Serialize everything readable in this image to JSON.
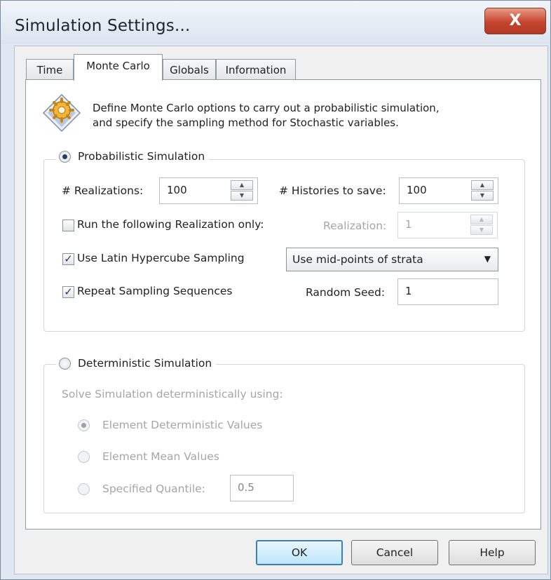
{
  "window": {
    "title": "Simulation Settings...",
    "close_label": "X"
  },
  "tabs": [
    {
      "label": "Time",
      "active": false
    },
    {
      "label": "Monte Carlo",
      "active": true
    },
    {
      "label": "Globals",
      "active": false
    },
    {
      "label": "Information",
      "active": false
    }
  ],
  "info": {
    "icon": "gear-diamond-icon",
    "line1": "Define Monte Carlo options to carry out a probabilistic simulation,",
    "line2": "and specify the sampling method for Stochastic variables."
  },
  "probabilistic": {
    "label": "Probabilistic Simulation",
    "selected": true,
    "realizations_label": "# Realizations:",
    "realizations_value": "100",
    "histories_label": "# Histories to save:",
    "histories_value": "100",
    "run_only_label": "Run the following Realization only:",
    "run_only_checked": false,
    "realization_label": "Realization:",
    "realization_value": "1",
    "lhs_label": "Use Latin Hypercube Sampling",
    "lhs_checked": true,
    "lhs_method": "Use mid-points of strata",
    "repeat_label": "Repeat Sampling Sequences",
    "repeat_checked": true,
    "seed_label": "Random Seed:",
    "seed_value": "1",
    "check_mark": "✓",
    "spin_up": "▲",
    "spin_down": "▼",
    "dropdown_arrow": "▼"
  },
  "deterministic": {
    "label": "Deterministic Simulation",
    "selected": false,
    "solve_label": "Solve Simulation deterministically using:",
    "options": [
      {
        "label": "Element Deterministic Values",
        "selected": true
      },
      {
        "label": "Element Mean Values",
        "selected": false
      },
      {
        "label": "Specified Quantile:",
        "selected": false
      }
    ],
    "quantile_value": "0.5"
  },
  "buttons": {
    "ok": "OK",
    "cancel": "Cancel",
    "help": "Help"
  }
}
